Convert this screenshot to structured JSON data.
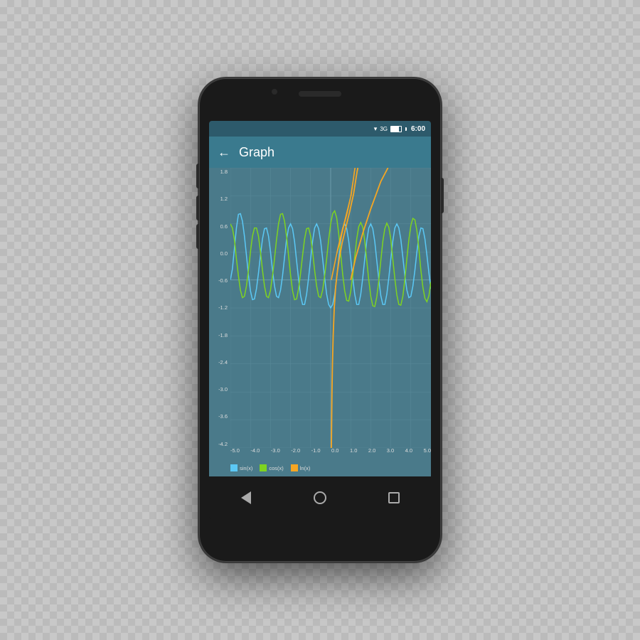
{
  "phone": {
    "status_bar": {
      "time": "6:00",
      "wifi": "▲",
      "signal": "3G",
      "battery_pct": 80
    },
    "app_bar": {
      "title": "Graph",
      "back_label": "←"
    },
    "chart": {
      "y_labels": [
        "1.8",
        "1.2",
        "0.6",
        "0.0",
        "-0.6",
        "-1.2",
        "-1.8",
        "-2.4",
        "-3.0",
        "-3.6",
        "-4.2"
      ],
      "x_labels": [
        "-5.0",
        "-4.0",
        "-3.0",
        "-2.0",
        "-1.0",
        "0.0",
        "1.0",
        "2.0",
        "3.0",
        "4.0",
        "5.0"
      ],
      "legend": [
        {
          "color": "#5bc8f5",
          "label": "sin(x)"
        },
        {
          "color": "#7ed321",
          "label": "cos(x)"
        },
        {
          "color": "#f5a623",
          "label": "ln(x)"
        }
      ],
      "grid_color": "#5a8a9a",
      "bg_color": "#4a7a8a"
    },
    "nav": {
      "back": "◁",
      "home": "○",
      "recent": "□"
    }
  }
}
